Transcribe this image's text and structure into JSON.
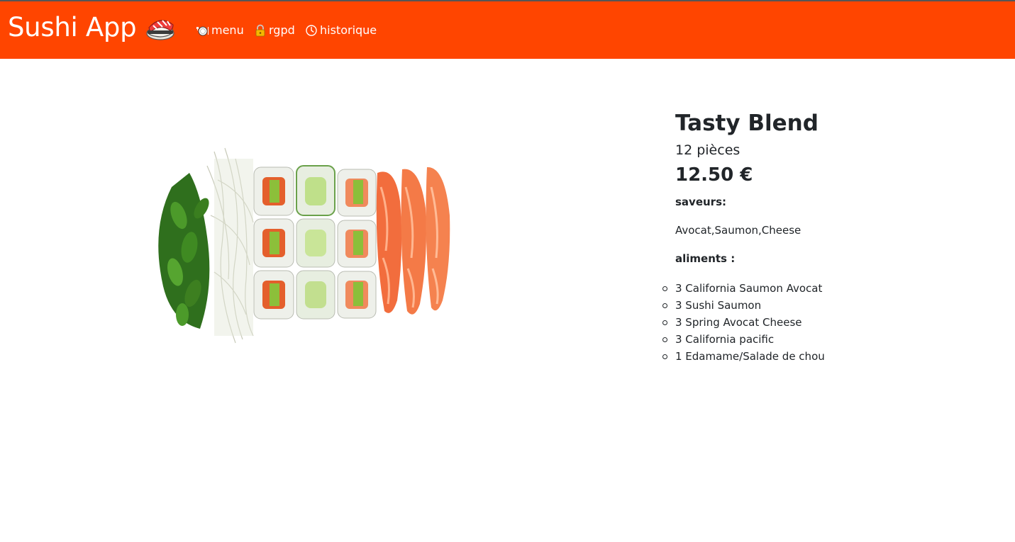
{
  "navbar": {
    "brand": "Sushi App",
    "brand_icon": "sushi-icon",
    "background_color": "#ff4500",
    "links": [
      {
        "label": "menu",
        "icon": "plate-icon"
      },
      {
        "label": "rgpd",
        "icon": "lock-icon"
      },
      {
        "label": "historique",
        "icon": "clock-icon"
      }
    ]
  },
  "product": {
    "image": "sushi-platter-image",
    "name": "Tasty Blend",
    "pieces": "12 pièces",
    "price": "12.50 €",
    "flavors_label": "saveurs:",
    "flavors": "Avocat,Saumon,Cheese",
    "ingredients_label": "aliments :",
    "ingredients": [
      "3 California Saumon Avocat",
      "3 Sushi Saumon",
      "3 Spring Avocat Cheese",
      "3 California pacific",
      "1 Edamame/Salade de chou"
    ]
  }
}
